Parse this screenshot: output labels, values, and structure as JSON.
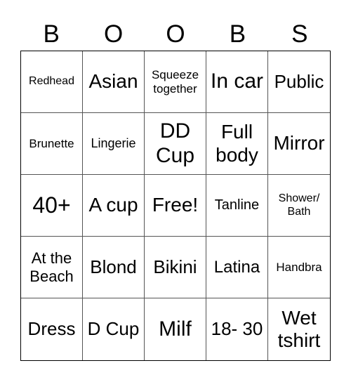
{
  "header": {
    "letters": [
      "B",
      "O",
      "O",
      "B",
      "S"
    ]
  },
  "cells": [
    "Redhead",
    "Asian",
    "Squeeze together",
    "In car",
    "Public",
    "Brunette",
    "Lingerie",
    "DD Cup",
    "Full body",
    "Mirror",
    "40+",
    "A cup",
    "Free!",
    "Tanline",
    "Shower/ Bath",
    "At the Beach",
    "Blond",
    "Bikini",
    "Latina",
    "Handbra",
    "Dress",
    "D Cup",
    "Milf",
    "18- 30",
    "Wet tshirt"
  ]
}
